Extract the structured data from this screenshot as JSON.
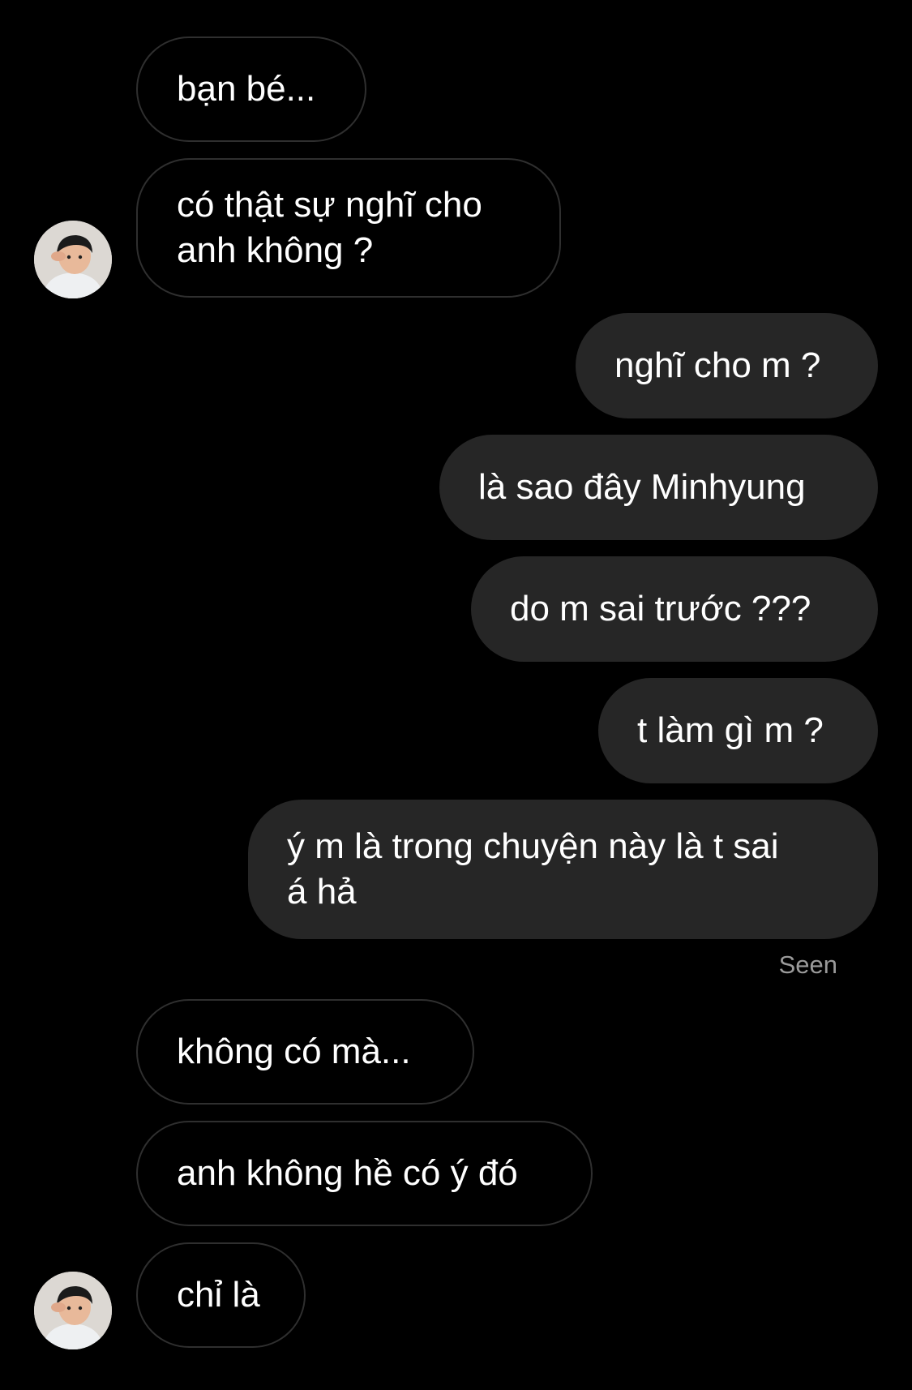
{
  "chat": {
    "messages": [
      {
        "text": "bạn bé..."
      },
      {
        "text": "có thật sự nghĩ cho\nanh không ?"
      },
      {
        "text": "nghĩ cho m ?"
      },
      {
        "text": "là sao đây Minhyung"
      },
      {
        "text": "do m sai trước ???"
      },
      {
        "text": "t làm gì m ?"
      },
      {
        "text": "ý m là trong chuyện này là t sai\ná hả"
      },
      {
        "text": "không có mà..."
      },
      {
        "text": "anh không hề có ý đó"
      },
      {
        "text": "chỉ là"
      }
    ],
    "seen_label": "Seen"
  },
  "colors": {
    "background": "#000000",
    "outgoing_bubble": "#262626",
    "incoming_border": "#2f2f2f",
    "text": "#ffffff",
    "seen_text": "#9a9a9a"
  }
}
